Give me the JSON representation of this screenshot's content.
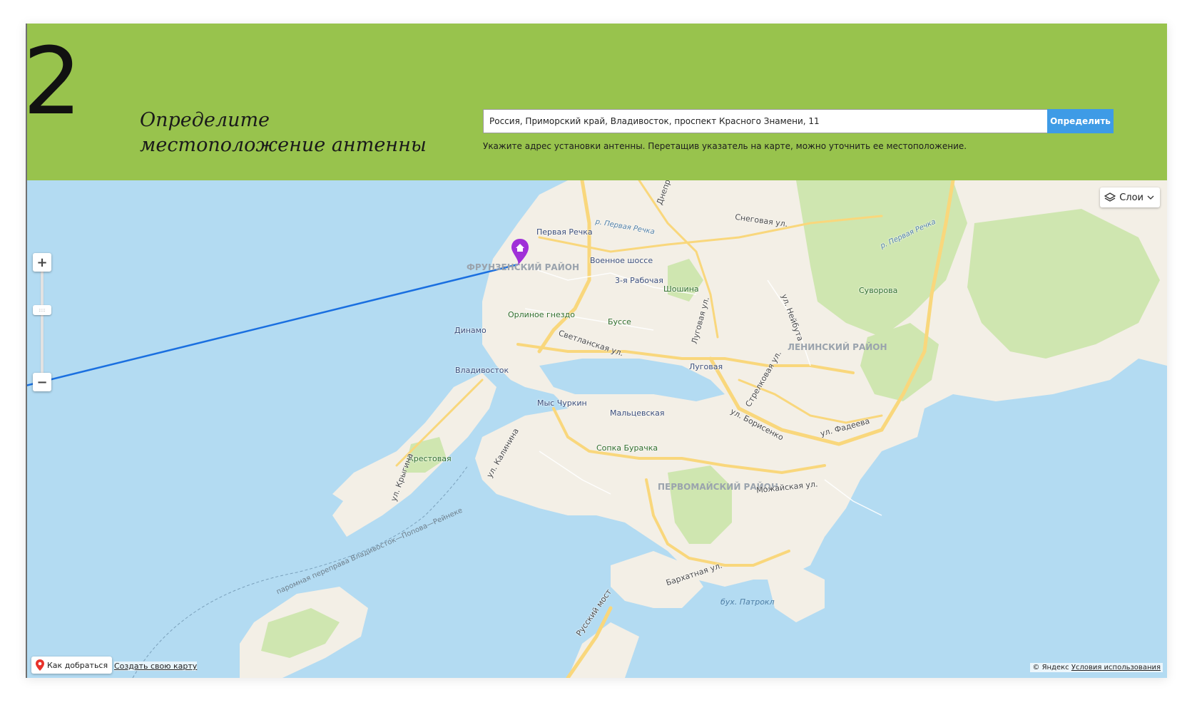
{
  "step": {
    "number": "2",
    "title": "Определите местоположение антенны"
  },
  "search": {
    "value": "Россия, Приморский край, Владивосток, проспект Красного Знамени, 11",
    "button_label": "Определить",
    "hint": "Укажите адрес установки антенны. Перетащив указатель на карте, можно уточнить ее местоположение."
  },
  "colors": {
    "header_bg": "#98c34d",
    "button_bg": "#3e9be6",
    "water": "#b3dbf2",
    "land": "#f3efe6",
    "park": "#cfe6b0",
    "road": "#f9d77c",
    "route_line": "#1a6fe0",
    "pin": "#a030d8"
  },
  "map": {
    "layers_label": "Слои",
    "zoom_in_label": "+",
    "zoom_out_label": "−",
    "route_label": "Как добраться",
    "create_map_label": "Создать свою карту",
    "copyright": "© Яндекс",
    "terms_label": "Условия использования",
    "labels": {
      "pervaya_rechka": "Первая Речка",
      "voennoe_shosse": "Военное шоссе",
      "rabochaya": "3-я Рабочая",
      "shoshina": "Шошина",
      "orlinoe": "Орлиное гнездо",
      "busse": "Буссе",
      "dinamo": "Динамо",
      "vladivostok": "Владивосток",
      "svetlanskaya": "Светланская ул.",
      "lugovaya": "Луговая",
      "lugovaya_st": "Луговая ул.",
      "snegovaya": "Снеговая ул.",
      "r_pervaya_rechka": "р. Первая Речка",
      "r_pervaya_rechka2": "р. Первая Речка",
      "suvorova": "Суворова",
      "neibuta": "ул. Нейбута",
      "streklovaya": "Стрелковая ул.",
      "leninsky": "ЛЕНИНСКИЙ РАЙОН",
      "frunzensky": "ФРУНЗЕНСКИЙ РАЙОН",
      "myschurkin": "Мыс Чуркин",
      "maltsevskaya": "Мальцевская",
      "borisenko": "ул. Борисенко",
      "fadeeva": "ул. Фадеева",
      "sopka_burachka": "Сопка Бурачка",
      "kalinina": "ул. Калинина",
      "krestovaya": "Крестовая",
      "krygina": "ул. Крыгина",
      "pervomaisky": "ПЕРВОМАЙСКИЙ РАЙОН",
      "mozhaiskaya": "Можайская ул.",
      "barkhatnaya": "Бархатная ул.",
      "patrokl": "бух. Патрокл",
      "russky_most": "Русский мост",
      "ferry": "паромная переправа Владивосток—Попова—Рейнеке",
      "dneprovskaya": "Днепр"
    }
  }
}
